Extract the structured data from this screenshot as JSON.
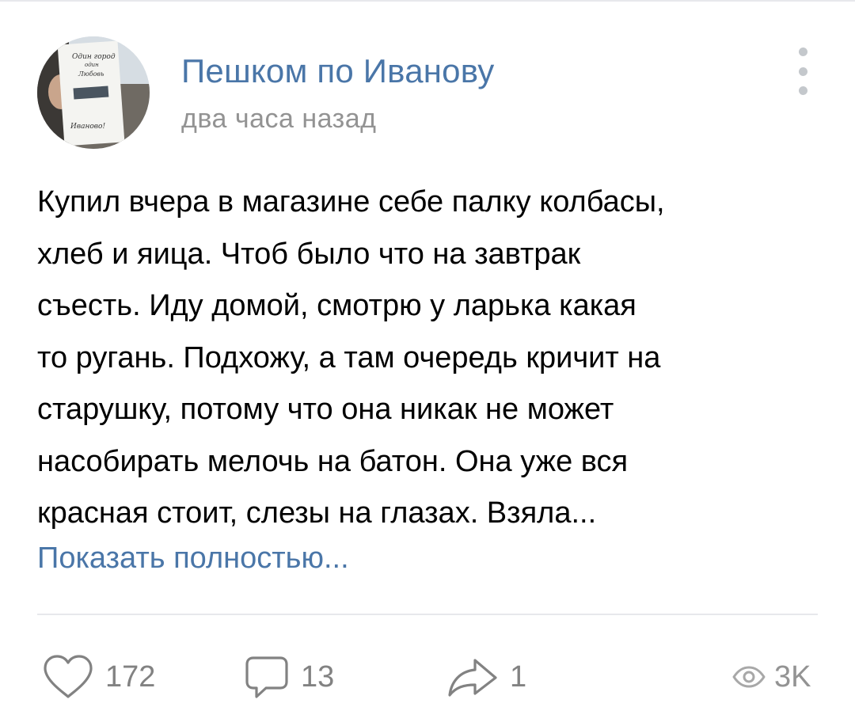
{
  "post": {
    "author_name": "Пешком по Иванову",
    "time": "два часа назад",
    "text_lines": [
      "Купил вчера в магазине себе палку колбасы,",
      "хлеб и яица. Чтоб было что на завтрак",
      "съесть. Иду домой, смотрю у ларька какая",
      "то ругань. Подхожу, а там очередь кричит на",
      "старушку, потому что она никак не может",
      "насобирать мелочь на батон. Она уже вся",
      "красная стоит, слезы на глазах. Взяла..."
    ],
    "show_more": "Показать полностью...",
    "avatar_sign_lines": [
      "Один город",
      "один",
      "Любовь",
      "Иваново!"
    ]
  },
  "actions": {
    "likes": "172",
    "comments": "13",
    "shares": "1",
    "views": "3K"
  },
  "icons": {
    "avatar": "avatar-photo",
    "menu": "more-vertical-icon",
    "like": "heart-icon",
    "comment": "comment-icon",
    "share": "share-icon",
    "views": "eye-icon"
  },
  "colors": {
    "link": "#4a76a8",
    "muted": "#939393",
    "icon": "#828282",
    "divider": "#e7e8ec"
  }
}
